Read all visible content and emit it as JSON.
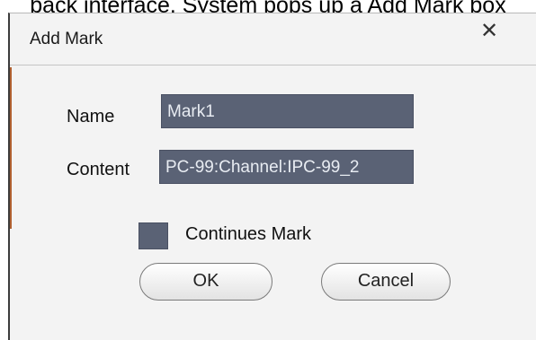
{
  "document": {
    "caption_fragment": "back interface. System pops up a Add Mark box"
  },
  "dialog": {
    "title": "Add Mark",
    "close_symbol": "✕",
    "name": {
      "label": "Name",
      "value": "Mark1"
    },
    "content": {
      "label": "Content",
      "value": "PC-99:Channel:IPC-99_2"
    },
    "continues_mark": {
      "label": "Continues Mark",
      "checked": false
    },
    "ok_label": "OK",
    "cancel_label": "Cancel"
  },
  "colors": {
    "field_background": "#5a6275",
    "field_text": "#e8ecf2",
    "dialog_background": "#f3f3f3"
  }
}
